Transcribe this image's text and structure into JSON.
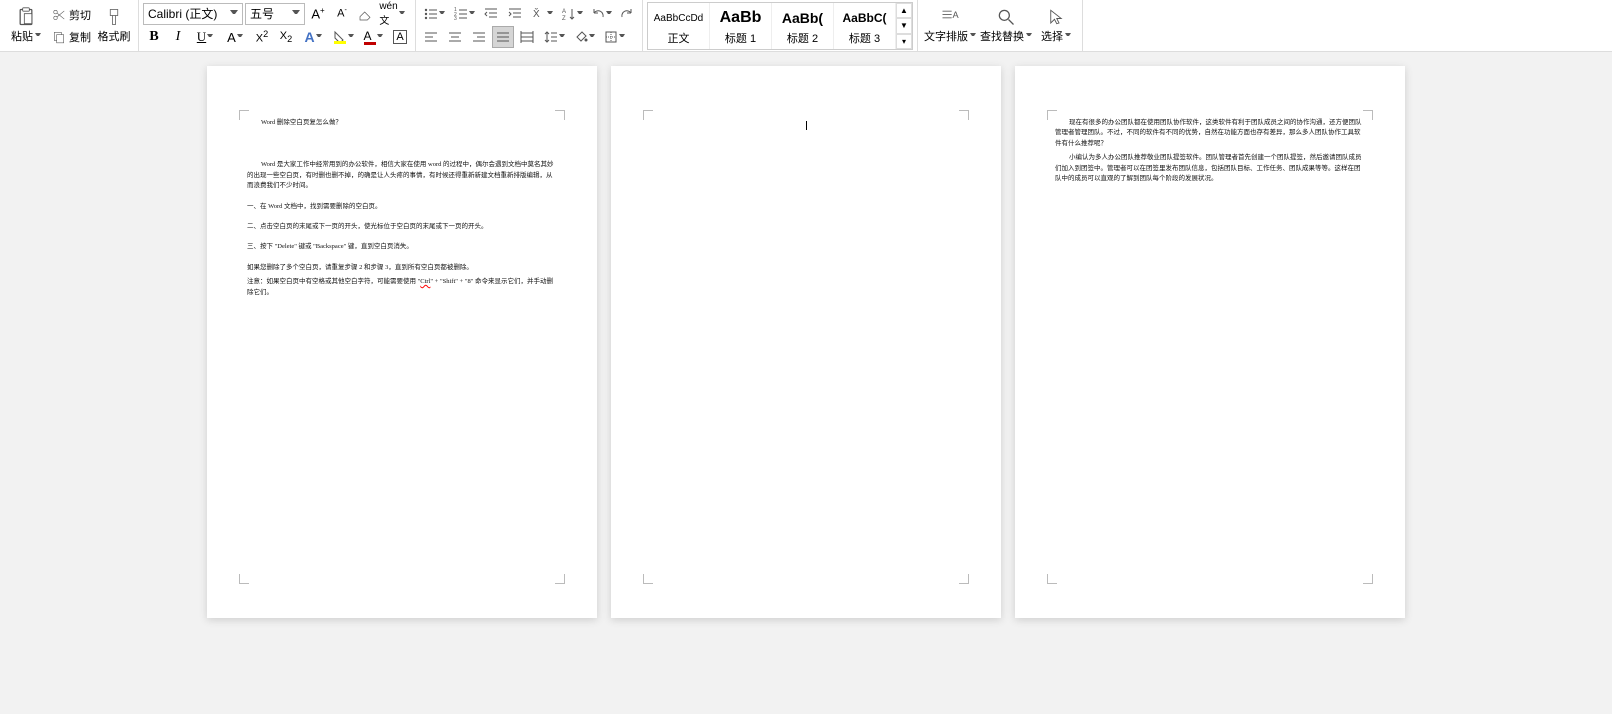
{
  "ribbon": {
    "clipboard": {
      "paste": "粘贴",
      "cut": "剪切",
      "copy": "复制",
      "format_painter": "格式刷"
    },
    "font": {
      "name": "Calibri (正文)",
      "size": "五号"
    },
    "styles": {
      "normal_preview": "AaBbCcDd",
      "normal_label": "正文",
      "h1_preview": "AaBb",
      "h1_label": "标题 1",
      "h2_preview": "AaBb(",
      "h2_label": "标题 2",
      "h3_preview": "AaBbC(",
      "h3_label": "标题 3"
    },
    "right": {
      "text_layout": "文字排版",
      "find_replace": "查找替换",
      "select": "选择"
    }
  },
  "doc": {
    "page1": {
      "title": "Word 删除空白页复怎么做？",
      "p1": "Word 是大家工作中经常用到的办公软件，相信大家在使用 word 的过程中，偶尔会遇到文档中莫名其妙的出现一些空白页，有时删也删不掉，的确是让人头疼的事情，有时候还得重新新建文档重新排版编辑，从而浪费我们不少时间。",
      "p2": "一、在 Word 文档中，找到需要删除的空白页。",
      "p3": "二、点击空白页的末尾或下一页的开头，使光标位于空白页的末尾或下一页的开头。",
      "p4": "三、按下 \"Delete\" 键或 \"Backspace\" 键，直到空白页消失。",
      "p5_a": "如果您删除了多个空白页，请重复步骤 2 和步骤 3，直到所有空白页都被删除。",
      "p5_b": "注意：如果空白页中有空格或其他空白字符，可能需要使用 \"",
      "p5_ctrl": "Ctrl",
      "p5_c": "\" + \"Shift\" + \"8\" 命令来显示它们，并手动删除它们。"
    },
    "page3": {
      "p1": "现在有很多的办公团队都在使用团队协作软件，这类软件有利于团队成员之间的协作沟通，还方便团队管理者管理团队。不过，不同的软件有不同的优势，自然在功能方面也存有差异，那么多人团队协作工具软件有什么推荐呢？",
      "p2": "小编认为多人办公团队推荐敬业团队提签软件。团队管理者首先创建一个团队提签，然后邀请团队成员们加入到团签中。管理者可以在团签里发布团队信息，包括团队目标、工作任务、团队成果等等。这样在团队中的成员可以直观的了解到团队每个阶段的发展状况。"
    }
  }
}
